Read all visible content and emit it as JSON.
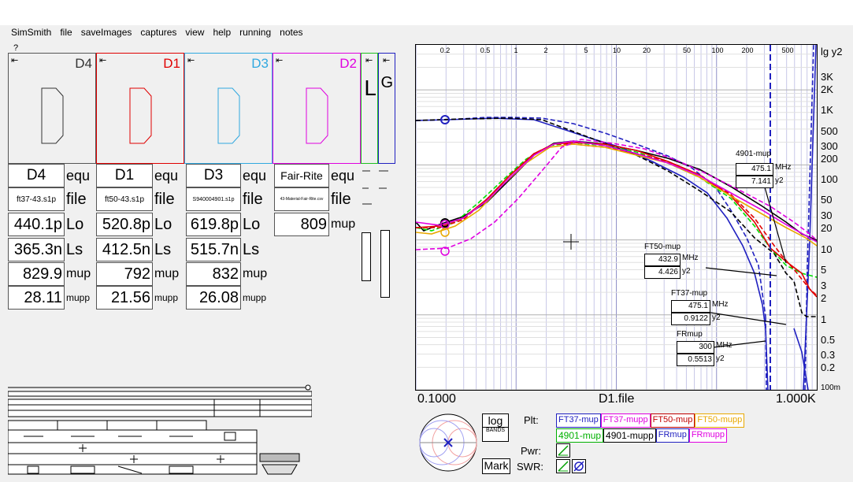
{
  "menu": [
    "SimSmith",
    "file",
    "saveImages",
    "captures",
    "view",
    "help",
    "running",
    "notes"
  ],
  "help_mark": "?",
  "arrow": "⇤",
  "panels": [
    {
      "label": "D4",
      "color": "#333333"
    },
    {
      "label": "D1",
      "color": "#e00000"
    },
    {
      "label": "D3",
      "color": "#30a8e0"
    },
    {
      "label": "D2",
      "color": "#e000e0"
    },
    {
      "label": "L",
      "color": "#20c020"
    },
    {
      "label": "G",
      "color": "#2020c0"
    }
  ],
  "columns": [
    {
      "name": "D4",
      "file": "ft37-43.s1p",
      "lo": "440.1p",
      "ls": "365.3n",
      "mup": "829.9",
      "mupp": "28.11"
    },
    {
      "name": "D1",
      "file": "ft50-43.s1p",
      "lo": "520.8p",
      "ls": "412.5n",
      "mup": "792",
      "mupp": "21.56"
    },
    {
      "name": "D3",
      "file": "S940004901.s1p",
      "lo": "619.8p",
      "ls": "515.7n",
      "mup": "832",
      "mupp": "26.08"
    },
    {
      "name": "Fair-Rite",
      "file": "43-Material-Fair-Rite.csv",
      "mup": "809"
    }
  ],
  "units": {
    "equ": "equ",
    "file": "file",
    "lo": "Lo",
    "ls": "Ls",
    "mup": "mup",
    "mupp": "mupp"
  },
  "plot": {
    "y_axis_title": "lg y2",
    "y_ticks": [
      "3K",
      "2K",
      "1K",
      "500",
      "300",
      "200",
      "100",
      "50",
      "30",
      "20",
      "10",
      "5",
      "3",
      "2",
      "1",
      "0.5",
      "0.3",
      "0.2",
      "100m"
    ],
    "x_ticks_top": [
      "0.2",
      "0.5",
      "1",
      "2",
      "5",
      "10",
      "20",
      "50",
      "100",
      "200",
      "500"
    ],
    "x_left": "0.1000",
    "x_center": "D1.file",
    "x_right": "1.000K"
  },
  "annotations": [
    {
      "title": "4901-mup",
      "value": "475.1",
      "unit": "MHz",
      "y2": "7.141",
      "y2label": "y2"
    },
    {
      "title": "FT50-mup",
      "value": "432.9",
      "unit": "MHz",
      "y2": "4.426",
      "y2label": "y2"
    },
    {
      "title": "FT37-mup",
      "value": "475.1",
      "unit": "MHz",
      "y2": "0.9122",
      "y2label": "y2"
    },
    {
      "title": "FRmup",
      "value": "300",
      "unit": "MHz",
      "y2": "0.5513",
      "y2label": "y2"
    }
  ],
  "controls": {
    "log": "log",
    "bands": "BANDS",
    "mark": "Mark",
    "plt": "Plt:",
    "pwr": "Pwr:",
    "swr": "SWR:"
  },
  "plt_buttons": [
    {
      "label": "FT37-mup",
      "color": "#2020c0"
    },
    {
      "label": "FT37-mupp",
      "color": "#e000e0"
    },
    {
      "label": "FT50-mup",
      "color": "#c00000"
    },
    {
      "label": "FT50-mupp",
      "color": "#e8a800"
    },
    {
      "label": "4901-mup",
      "color": "#00b000"
    },
    {
      "label": "4901-mupp",
      "color": "#000000"
    },
    {
      "label": "FRmup",
      "color": "#2020c0"
    },
    {
      "label": "FRmupp",
      "color": "#e000e0"
    }
  ]
}
